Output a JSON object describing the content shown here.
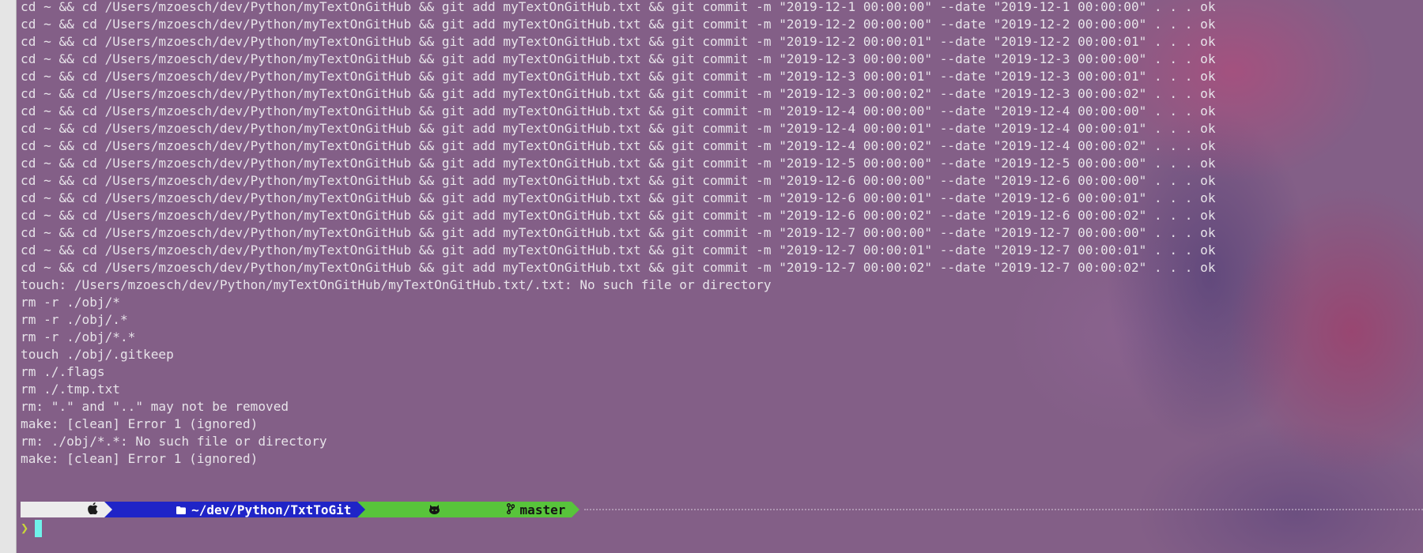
{
  "output_lines": [
    "cd ~ && cd /Users/mzoesch/dev/Python/myTextOnGitHub && git add myTextOnGitHub.txt && git commit -m \"2019-12-1 00:00:00\" --date \"2019-12-1 00:00:00\" . . . ok",
    "cd ~ && cd /Users/mzoesch/dev/Python/myTextOnGitHub && git add myTextOnGitHub.txt && git commit -m \"2019-12-2 00:00:00\" --date \"2019-12-2 00:00:00\" . . . ok",
    "cd ~ && cd /Users/mzoesch/dev/Python/myTextOnGitHub && git add myTextOnGitHub.txt && git commit -m \"2019-12-2 00:00:01\" --date \"2019-12-2 00:00:01\" . . . ok",
    "cd ~ && cd /Users/mzoesch/dev/Python/myTextOnGitHub && git add myTextOnGitHub.txt && git commit -m \"2019-12-3 00:00:00\" --date \"2019-12-3 00:00:00\" . . . ok",
    "cd ~ && cd /Users/mzoesch/dev/Python/myTextOnGitHub && git add myTextOnGitHub.txt && git commit -m \"2019-12-3 00:00:01\" --date \"2019-12-3 00:00:01\" . . . ok",
    "cd ~ && cd /Users/mzoesch/dev/Python/myTextOnGitHub && git add myTextOnGitHub.txt && git commit -m \"2019-12-3 00:00:02\" --date \"2019-12-3 00:00:02\" . . . ok",
    "cd ~ && cd /Users/mzoesch/dev/Python/myTextOnGitHub && git add myTextOnGitHub.txt && git commit -m \"2019-12-4 00:00:00\" --date \"2019-12-4 00:00:00\" . . . ok",
    "cd ~ && cd /Users/mzoesch/dev/Python/myTextOnGitHub && git add myTextOnGitHub.txt && git commit -m \"2019-12-4 00:00:01\" --date \"2019-12-4 00:00:01\" . . . ok",
    "cd ~ && cd /Users/mzoesch/dev/Python/myTextOnGitHub && git add myTextOnGitHub.txt && git commit -m \"2019-12-4 00:00:02\" --date \"2019-12-4 00:00:02\" . . . ok",
    "cd ~ && cd /Users/mzoesch/dev/Python/myTextOnGitHub && git add myTextOnGitHub.txt && git commit -m \"2019-12-5 00:00:00\" --date \"2019-12-5 00:00:00\" . . . ok",
    "cd ~ && cd /Users/mzoesch/dev/Python/myTextOnGitHub && git add myTextOnGitHub.txt && git commit -m \"2019-12-6 00:00:00\" --date \"2019-12-6 00:00:00\" . . . ok",
    "cd ~ && cd /Users/mzoesch/dev/Python/myTextOnGitHub && git add myTextOnGitHub.txt && git commit -m \"2019-12-6 00:00:01\" --date \"2019-12-6 00:00:01\" . . . ok",
    "cd ~ && cd /Users/mzoesch/dev/Python/myTextOnGitHub && git add myTextOnGitHub.txt && git commit -m \"2019-12-6 00:00:02\" --date \"2019-12-6 00:00:02\" . . . ok",
    "cd ~ && cd /Users/mzoesch/dev/Python/myTextOnGitHub && git add myTextOnGitHub.txt && git commit -m \"2019-12-7 00:00:00\" --date \"2019-12-7 00:00:00\" . . . ok",
    "cd ~ && cd /Users/mzoesch/dev/Python/myTextOnGitHub && git add myTextOnGitHub.txt && git commit -m \"2019-12-7 00:00:01\" --date \"2019-12-7 00:00:01\" . . . ok",
    "cd ~ && cd /Users/mzoesch/dev/Python/myTextOnGitHub && git add myTextOnGitHub.txt && git commit -m \"2019-12-7 00:00:02\" --date \"2019-12-7 00:00:02\" . . . ok",
    "touch: /Users/mzoesch/dev/Python/myTextOnGitHub/myTextOnGitHub.txt/.txt: No such file or directory",
    "rm -r ./obj/*",
    "rm -r ./obj/.*",
    "rm -r ./obj/*.*",
    "touch ./obj/.gitkeep",
    "rm ./.flags",
    "rm ./.tmp.txt",
    "rm: \".\" and \"..\" may not be removed",
    "make: [clean] Error 1 (ignored)",
    "rm: ./obj/*.*: No such file or directory",
    "make: [clean] Error 1 (ignored)"
  ],
  "prompt": {
    "os_icon": "apple-icon",
    "directory_icon": "folder-icon",
    "directory": "~/dev/Python/TxtToGit",
    "git_icon": "github-icon",
    "branch_icon": "git-branch-icon",
    "branch": "master",
    "prompt_char": "❯"
  },
  "colors": {
    "background": "#835f87",
    "text": "#e7e3e9",
    "os_segment": "#ececec",
    "dir_segment": "#1f24c7",
    "git_segment": "#58c43b",
    "cursor": "#6ff2ea",
    "prompt_char": "#c8d63a"
  }
}
